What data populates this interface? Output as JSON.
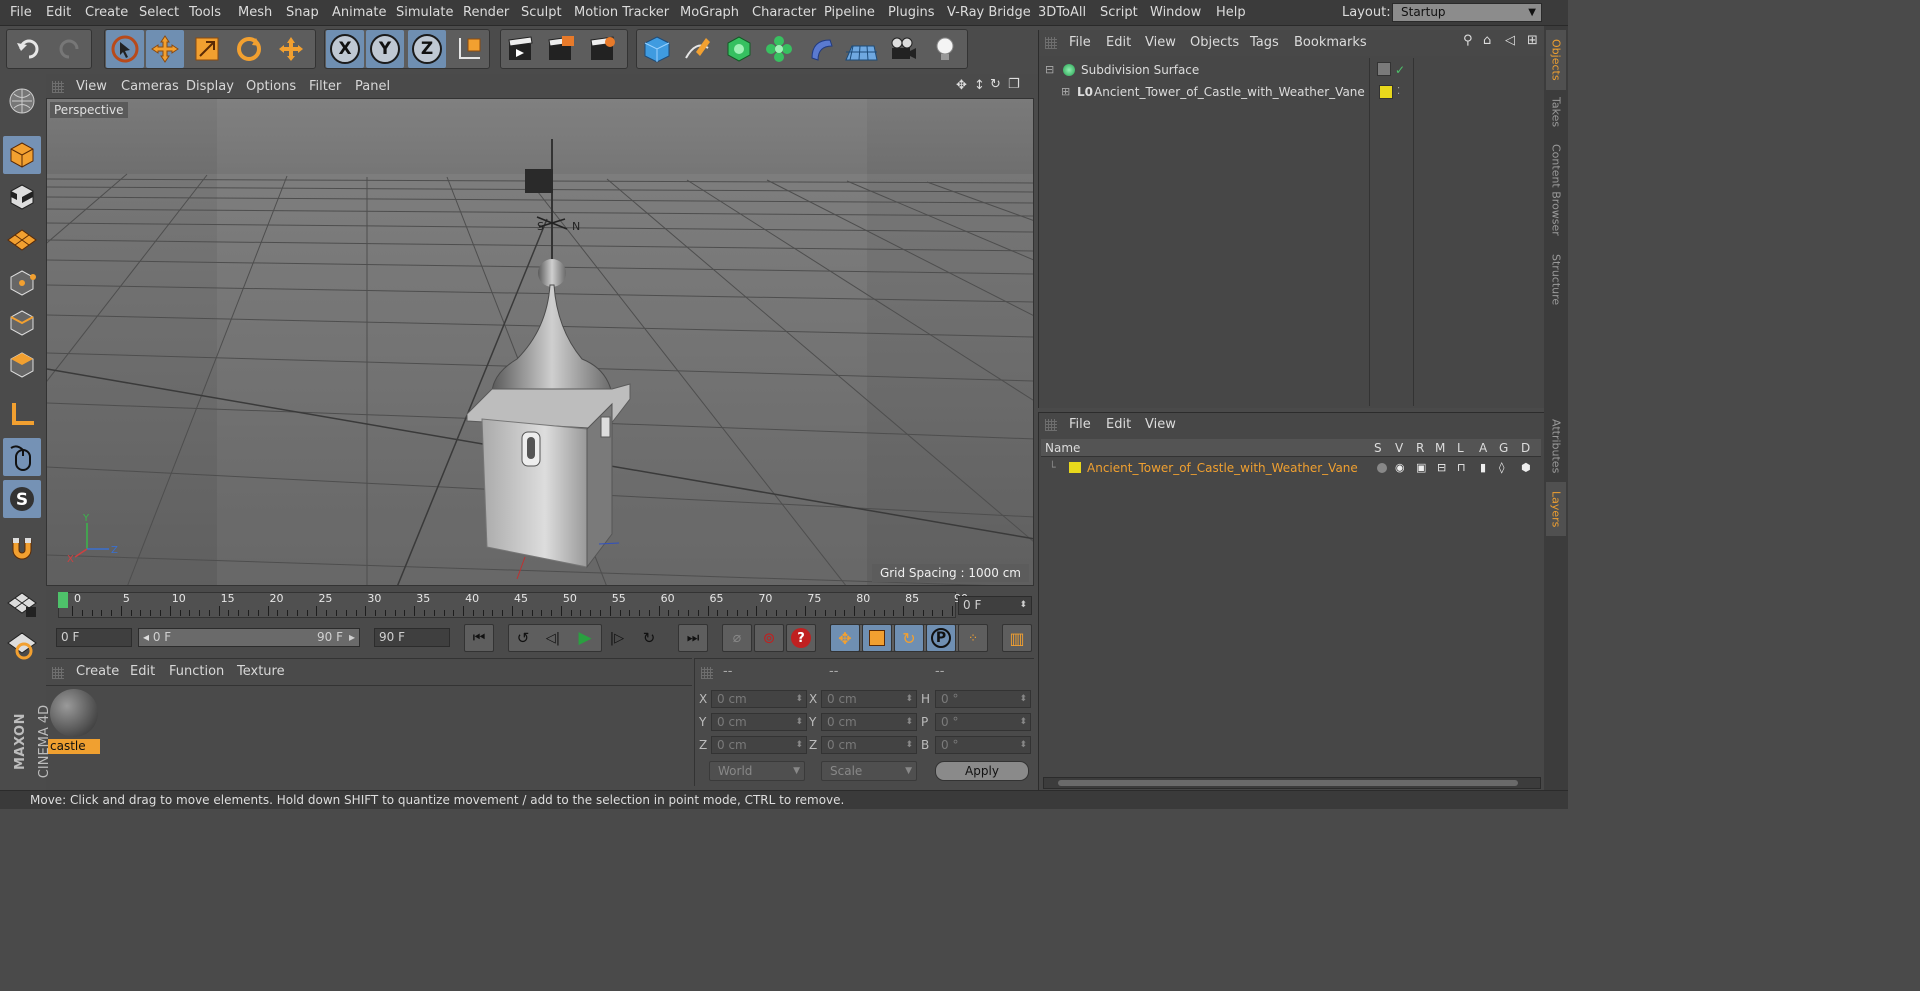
{
  "menubar": {
    "items": [
      "File",
      "Edit",
      "Create",
      "Select",
      "Tools",
      "Mesh",
      "Snap",
      "Animate",
      "Simulate",
      "Render",
      "Sculpt",
      "Motion Tracker",
      "MoGraph",
      "Character",
      "Pipeline",
      "Plugins",
      "V-Ray Bridge",
      "3DToAll",
      "Script",
      "Window",
      "Help"
    ],
    "layout_label": "Layout:",
    "layout_value": "Startup"
  },
  "toolbar": {
    "axis_x": "X",
    "axis_y": "Y",
    "axis_z": "Z"
  },
  "viewport": {
    "menu": [
      "View",
      "Cameras",
      "Display",
      "Options",
      "Filter",
      "Panel"
    ],
    "label": "Perspective",
    "grid_spacing": "Grid Spacing : 1000 cm",
    "axis_x": "X",
    "axis_y": "Y",
    "axis_z": "Z"
  },
  "timeline": {
    "ticks": [
      "0",
      "5",
      "10",
      "15",
      "20",
      "25",
      "30",
      "35",
      "40",
      "45",
      "50",
      "55",
      "60",
      "65",
      "70",
      "75",
      "80",
      "85",
      "90"
    ],
    "current_frame": "0 F"
  },
  "playbar": {
    "start_frame": "0 F",
    "range_start": "0 F",
    "range_end": "90 F",
    "end_frame": "90 F"
  },
  "material_manager": {
    "menu": [
      "Create",
      "Edit",
      "Function",
      "Texture"
    ],
    "material_name": "castle",
    "brand_line1": "MAXON",
    "brand_line2": "CINEMA 4D"
  },
  "coordinates": {
    "headers": [
      "--",
      "--",
      "--"
    ],
    "rows": [
      {
        "l1": "X",
        "v1": "0 cm",
        "l2": "X",
        "v2": "0 cm",
        "l3": "H",
        "v3": "0 °"
      },
      {
        "l1": "Y",
        "v1": "0 cm",
        "l2": "Y",
        "v2": "0 cm",
        "l3": "P",
        "v3": "0 °"
      },
      {
        "l1": "Z",
        "v1": "0 cm",
        "l2": "Z",
        "v2": "0 cm",
        "l3": "B",
        "v3": "0 °"
      }
    ],
    "mode_world": "World",
    "mode_scale": "Scale",
    "apply_label": "Apply"
  },
  "object_manager": {
    "menu": [
      "File",
      "Edit",
      "View",
      "Objects",
      "Tags",
      "Bookmarks"
    ],
    "objects": [
      {
        "name": "Subdivision Surface"
      },
      {
        "name": "Ancient_Tower_of_Castle_with_Weather_Vane"
      }
    ]
  },
  "layer_manager": {
    "menu": [
      "File",
      "Edit",
      "View"
    ],
    "headers": {
      "name": "Name",
      "cols": [
        "S",
        "V",
        "R",
        "M",
        "L",
        "A",
        "G",
        "D"
      ]
    },
    "layers": [
      {
        "name": "Ancient_Tower_of_Castle_with_Weather_Vane",
        "color": "#e8d81c"
      }
    ]
  },
  "side_tabs": [
    "Objects",
    "Takes",
    "Content Browser",
    "Structure",
    "Attributes",
    "Layers"
  ],
  "status": {
    "text": "Move: Click and drag to move elements. Hold down SHIFT to quantize movement / add to the selection in point mode, CTRL to remove."
  },
  "colors": {
    "accent_orange": "#f0a030",
    "selected_blue": "#6f8fb2",
    "layer_yellow": "#e8d81c"
  }
}
